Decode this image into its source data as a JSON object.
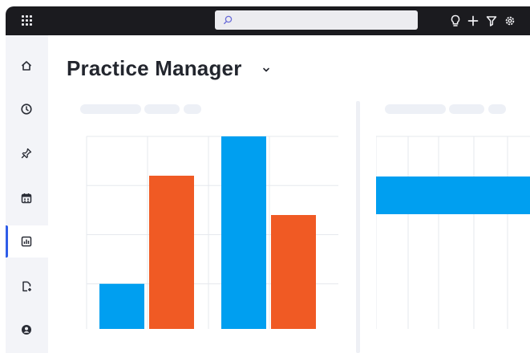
{
  "app": {
    "title": "Practice Manager"
  },
  "search": {
    "placeholder": ""
  },
  "toolbar": {
    "icons": [
      "lightbulb-icon",
      "plus-icon",
      "filter-icon",
      "settings-icon"
    ]
  },
  "sidebar": {
    "items": [
      {
        "icon": "home-icon",
        "active": false
      },
      {
        "icon": "clock-icon",
        "active": false
      },
      {
        "icon": "pin-icon",
        "active": false
      },
      {
        "icon": "calendar-icon",
        "active": false
      },
      {
        "icon": "reports-icon",
        "active": true
      },
      {
        "icon": "add-document-icon",
        "active": false
      },
      {
        "icon": "account-icon",
        "active": false
      }
    ]
  },
  "colors": {
    "accent": "#2f5de8",
    "series_blue": "#009ff0",
    "series_orange": "#f05a24",
    "topbar": "#1b1b1f"
  },
  "chart_data": [
    {
      "type": "bar",
      "categories": [
        "",
        ""
      ],
      "series": [
        {
          "values": [
            1,
            4
          ]
        },
        {
          "values": [
            3.2,
            2.4
          ]
        }
      ],
      "ylim": [
        0,
        4
      ],
      "grid": true
    },
    {
      "type": "bar",
      "orientation": "horizontal",
      "categories": [
        ""
      ],
      "series": [
        {
          "values": [
            1
          ]
        }
      ],
      "grid": true
    }
  ]
}
